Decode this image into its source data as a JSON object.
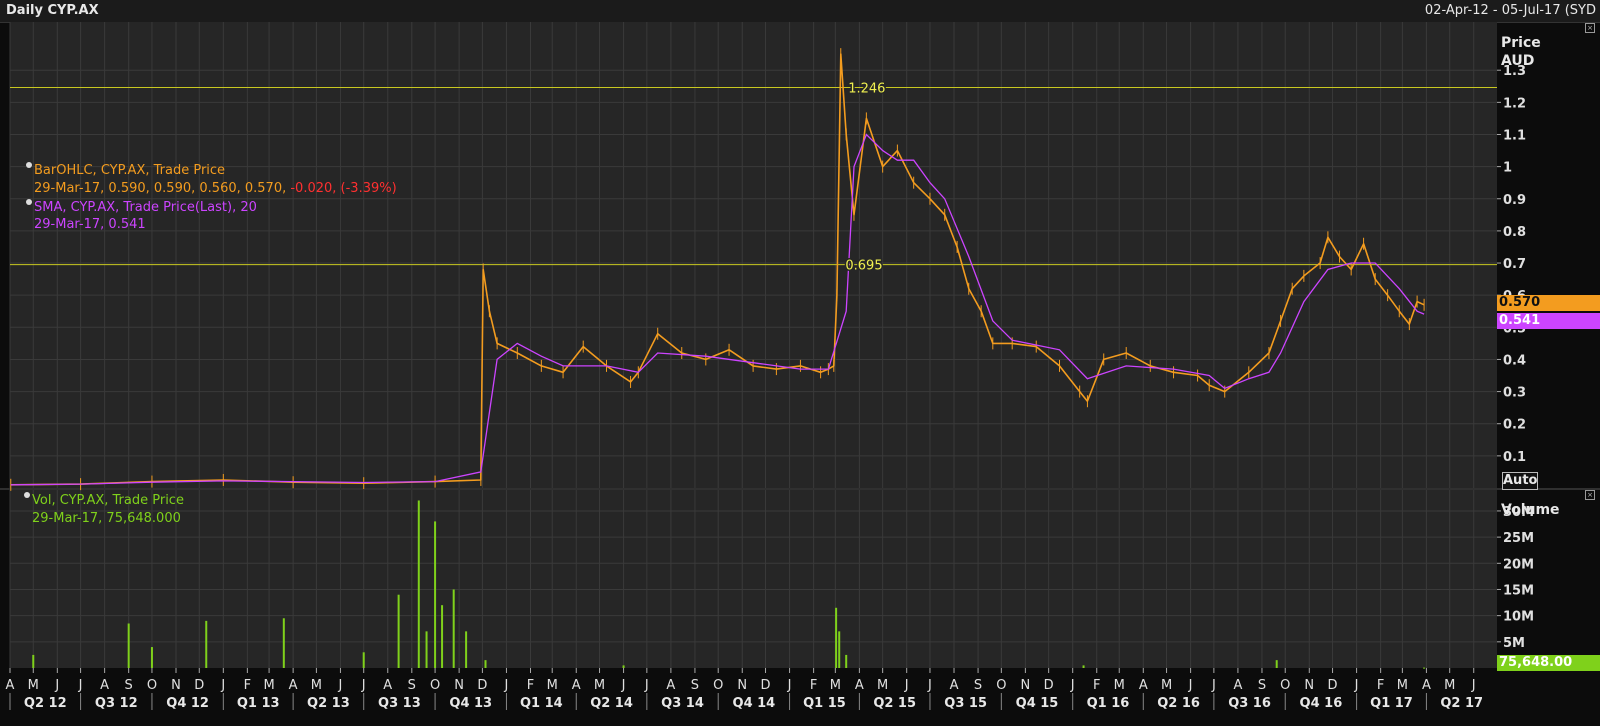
{
  "header": {
    "title": "Daily CYP.AX",
    "date_range": "02-Apr-12 - 05-Jul-17 (SYD"
  },
  "legend": {
    "ohlc_label": "BarOHLC, CYP.AX, Trade Price",
    "ohlc_values": "29-Mar-17, 0.590, 0.590, 0.560, 0.570,",
    "ohlc_change": "-0.020, (-3.39%)",
    "sma_label": "SMA, CYP.AX, Trade Price(Last),",
    "sma_period": "20",
    "sma_values": "29-Mar-17, 0.541",
    "vol_label": "Vol, CYP.AX, Trade Price",
    "vol_values": "29-Mar-17, 75,648.000"
  },
  "price_axis": {
    "title_line1": "Price",
    "title_line2": "AUD",
    "auto_button": "Auto",
    "last_price_tag": "0.570",
    "last_sma_tag": "0.541"
  },
  "volume_axis": {
    "title": "Volume",
    "last_volume_tag": "75,648.00"
  },
  "colors": {
    "price": "#f39c1f",
    "sma": "#cc44ff",
    "volume": "#7fd11b",
    "hline": "#c8c820",
    "down_change": "#ff3030"
  },
  "chart_data": [
    {
      "type": "line",
      "title": "Daily CYP.AX",
      "ylabel": "Price AUD",
      "ylim": [
        0,
        1.45
      ],
      "yticks": [
        "0.1",
        "0.2",
        "0.3",
        "0.4",
        "0.5",
        "0.6",
        "0.7",
        "0.8",
        "0.9",
        "1",
        "1.1",
        "1.2",
        "1.3"
      ],
      "x_month_ticks": [
        "A",
        "M",
        "J",
        "J",
        "A",
        "S",
        "O",
        "N",
        "D",
        "J",
        "F",
        "M",
        "A",
        "M",
        "J",
        "J",
        "A",
        "S",
        "O",
        "N",
        "D",
        "J",
        "F",
        "M",
        "A",
        "M",
        "J",
        "J",
        "A",
        "S",
        "O",
        "N",
        "D",
        "J",
        "F",
        "M",
        "A",
        "M",
        "J",
        "J",
        "A",
        "S",
        "O",
        "N",
        "D",
        "J",
        "F",
        "M",
        "A",
        "M",
        "J",
        "J",
        "A",
        "S",
        "O",
        "N",
        "D",
        "J",
        "F",
        "M",
        "A",
        "M",
        "J"
      ],
      "x_month_start": "2012-04",
      "x_quarter_ticks": [
        "Q2 12",
        "Q3 12",
        "Q4 12",
        "Q1 13",
        "Q2 13",
        "Q3 13",
        "Q4 13",
        "Q1 14",
        "Q2 14",
        "Q3 14",
        "Q4 14",
        "Q1 15",
        "Q2 15",
        "Q3 15",
        "Q4 15",
        "Q1 16",
        "Q2 16",
        "Q3 16",
        "Q4 16",
        "Q1 17",
        "Q2 17"
      ],
      "horizontal_lines": [
        {
          "label": "1.246",
          "value": 1.246
        },
        {
          "label": "0.695",
          "value": 0.695
        }
      ],
      "series": [
        {
          "name": "BarOHLC, CYP.AX, Trade Price",
          "x": [
            "2012-04-02",
            "2012-07-01",
            "2012-10-01",
            "2013-01-01",
            "2013-04-01",
            "2013-07-01",
            "2013-10-01",
            "2013-11-29",
            "2013-12-02",
            "2013-12-10",
            "2013-12-20",
            "2014-01-15",
            "2014-02-15",
            "2014-03-15",
            "2014-04-10",
            "2014-05-10",
            "2014-06-10",
            "2014-06-20",
            "2014-07-15",
            "2014-08-15",
            "2014-09-15",
            "2014-10-15",
            "2014-11-15",
            "2014-12-15",
            "2015-01-15",
            "2015-02-10",
            "2015-02-20",
            "2015-02-27",
            "2015-03-03",
            "2015-03-08",
            "2015-03-15",
            "2015-03-25",
            "2015-04-10",
            "2015-05-01",
            "2015-05-20",
            "2015-06-10",
            "2015-07-01",
            "2015-07-20",
            "2015-08-05",
            "2015-08-20",
            "2015-09-05",
            "2015-09-20",
            "2015-10-15",
            "2015-11-15",
            "2015-12-15",
            "2016-01-10",
            "2016-01-20",
            "2016-02-10",
            "2016-03-10",
            "2016-04-10",
            "2016-05-10",
            "2016-06-10",
            "2016-06-25",
            "2016-07-15",
            "2016-08-15",
            "2016-09-10",
            "2016-09-25",
            "2016-10-10",
            "2016-10-25",
            "2016-11-15",
            "2016-11-25",
            "2016-12-10",
            "2016-12-25",
            "2017-01-10",
            "2017-01-25",
            "2017-02-10",
            "2017-02-25",
            "2017-03-10",
            "2017-03-20",
            "2017-03-29"
          ],
          "values": [
            0.01,
            0.012,
            0.02,
            0.025,
            0.018,
            0.015,
            0.02,
            0.025,
            0.68,
            0.55,
            0.45,
            0.42,
            0.38,
            0.36,
            0.44,
            0.38,
            0.33,
            0.36,
            0.48,
            0.42,
            0.4,
            0.43,
            0.38,
            0.37,
            0.38,
            0.36,
            0.37,
            0.38,
            0.6,
            1.35,
            1.1,
            0.85,
            1.15,
            1.0,
            1.05,
            0.95,
            0.9,
            0.85,
            0.75,
            0.62,
            0.55,
            0.45,
            0.45,
            0.44,
            0.38,
            0.3,
            0.27,
            0.4,
            0.42,
            0.38,
            0.36,
            0.35,
            0.32,
            0.3,
            0.36,
            0.42,
            0.52,
            0.62,
            0.66,
            0.7,
            0.78,
            0.72,
            0.68,
            0.76,
            0.65,
            0.6,
            0.55,
            0.51,
            0.58,
            0.57
          ]
        },
        {
          "name": "SMA, CYP.AX, Trade Price(Last), 20",
          "x": [
            "2012-04-02",
            "2012-07-01",
            "2012-10-01",
            "2013-01-01",
            "2013-04-01",
            "2013-07-01",
            "2013-10-01",
            "2013-11-29",
            "2013-12-20",
            "2014-01-15",
            "2014-02-15",
            "2014-03-15",
            "2014-05-10",
            "2014-06-20",
            "2014-07-15",
            "2014-09-15",
            "2014-11-15",
            "2015-01-15",
            "2015-02-20",
            "2015-03-15",
            "2015-03-25",
            "2015-04-10",
            "2015-05-01",
            "2015-05-20",
            "2015-06-10",
            "2015-07-01",
            "2015-07-20",
            "2015-08-20",
            "2015-09-20",
            "2015-10-15",
            "2015-12-15",
            "2016-01-20",
            "2016-03-10",
            "2016-05-10",
            "2016-06-25",
            "2016-07-15",
            "2016-08-15",
            "2016-09-10",
            "2016-09-25",
            "2016-10-25",
            "2016-11-25",
            "2016-12-25",
            "2017-01-25",
            "2017-02-25",
            "2017-03-20",
            "2017-03-29"
          ],
          "values": [
            0.01,
            0.012,
            0.018,
            0.022,
            0.02,
            0.017,
            0.02,
            0.05,
            0.4,
            0.45,
            0.41,
            0.38,
            0.38,
            0.36,
            0.42,
            0.41,
            0.39,
            0.37,
            0.37,
            0.55,
            1.0,
            1.1,
            1.05,
            1.02,
            1.02,
            0.95,
            0.9,
            0.72,
            0.52,
            0.46,
            0.43,
            0.34,
            0.38,
            0.37,
            0.35,
            0.31,
            0.34,
            0.36,
            0.42,
            0.58,
            0.68,
            0.7,
            0.7,
            0.62,
            0.55,
            0.541
          ]
        }
      ]
    },
    {
      "type": "bar",
      "title": "Vol, CYP.AX, Trade Price",
      "ylabel": "Volume",
      "ylim": [
        0,
        34000000
      ],
      "yticks": [
        "5M",
        "10M",
        "15M",
        "20M",
        "25M",
        "30M"
      ],
      "series": [
        {
          "name": "Vol, CYP.AX, Trade Price",
          "x": [
            "2012-05-01",
            "2012-09-01",
            "2012-10-01",
            "2012-12-10",
            "2013-03-20",
            "2013-07-01",
            "2013-08-15",
            "2013-09-10",
            "2013-09-20",
            "2013-10-01",
            "2013-10-10",
            "2013-10-25",
            "2013-11-10",
            "2013-12-05",
            "2014-06-01",
            "2015-03-02",
            "2015-03-06",
            "2015-03-15",
            "2016-01-15",
            "2016-09-20",
            "2017-03-29"
          ],
          "values": [
            2500000,
            8500000,
            4000000,
            9000000,
            9500000,
            3000000,
            14000000,
            32000000,
            7000000,
            28000000,
            12000000,
            15000000,
            7000000,
            1500000,
            500000,
            11500000,
            7000000,
            2500000,
            500000,
            1500000,
            75648
          ]
        }
      ]
    }
  ]
}
